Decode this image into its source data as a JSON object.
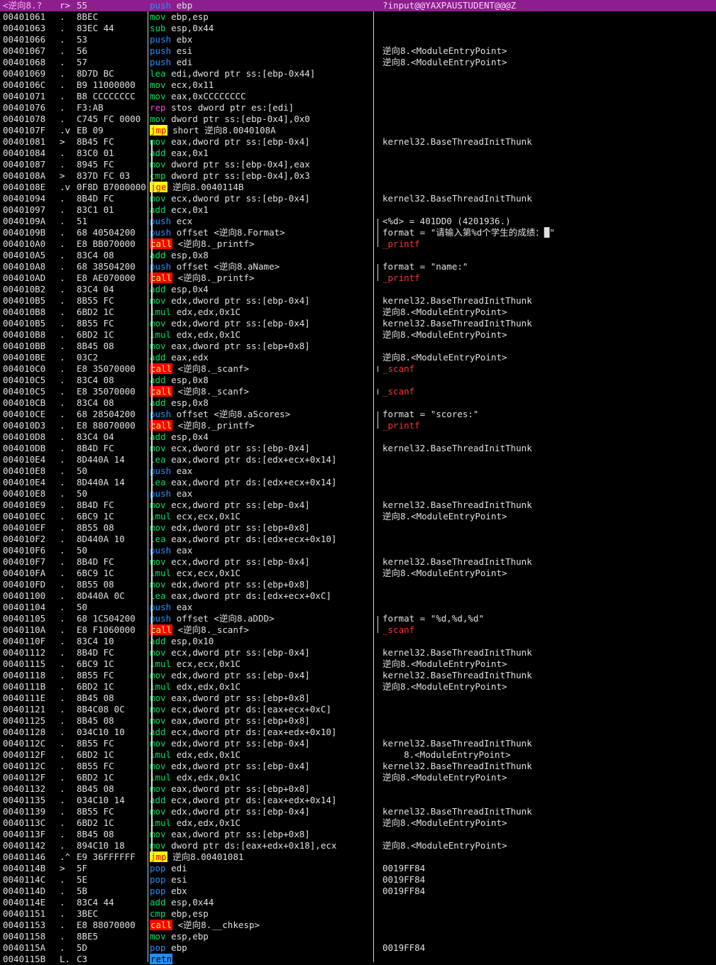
{
  "view": "disassembly",
  "selected_row_index": 0,
  "colors": {
    "background": "#000000",
    "selection": "#8e1e8e",
    "push_pop": "#1e90ff",
    "mov_add": "#00e060",
    "rep": "#ff3fd0",
    "call_bg": "#ff0000",
    "jump_bg": "#ffff00",
    "retn_bg": "#1e90ff",
    "func_comment": "#ff3030"
  },
  "rows": [
    {
      "addr": "<逆向8.?",
      "flow": "r>",
      "hex": "55",
      "mn": "push",
      "ops": "ebp",
      "cmt": "?input@@YAXPAUSTUDENT@@@Z"
    },
    {
      "addr": "00401061",
      "flow": ".",
      "hex": "8BEC",
      "mn": "mov",
      "ops": "ebp,esp",
      "cmt": ""
    },
    {
      "addr": "00401063",
      "flow": ".",
      "hex": "83EC 44",
      "mn": "sub",
      "ops": "esp,0x44",
      "cmt": ""
    },
    {
      "addr": "00401066",
      "flow": ".",
      "hex": "53",
      "mn": "push",
      "ops": "ebx",
      "cmt": ""
    },
    {
      "addr": "00401067",
      "flow": ".",
      "hex": "56",
      "mn": "push",
      "ops": "esi",
      "cmt": "逆向8.<ModuleEntryPoint>"
    },
    {
      "addr": "00401068",
      "flow": ".",
      "hex": "57",
      "mn": "push",
      "ops": "edi",
      "cmt": "逆向8.<ModuleEntryPoint>"
    },
    {
      "addr": "00401069",
      "flow": ".",
      "hex": "8D7D BC",
      "mn": "lea",
      "ops": "edi,dword ptr ss:[ebp-0x44]",
      "cmt": ""
    },
    {
      "addr": "0040106C",
      "flow": ".",
      "hex": "B9 11000000",
      "mn": "mov",
      "ops": "ecx,0x11",
      "cmt": ""
    },
    {
      "addr": "00401071",
      "flow": ".",
      "hex": "B8 CCCCCCCC",
      "mn": "mov",
      "ops": "eax,0xCCCCCCCC",
      "cmt": ""
    },
    {
      "addr": "00401076",
      "flow": ".",
      "hex": "F3:AB",
      "mn": "rep",
      "ops": "stos dword ptr es:[edi]",
      "cmt": ""
    },
    {
      "addr": "00401078",
      "flow": ".",
      "hex": "C745 FC 0000",
      "mn": "mov",
      "ops": "dword ptr ss:[ebp-0x4],0x0",
      "cmt": ""
    },
    {
      "addr": "0040107F",
      "flow": ".v",
      "hex": "EB 09",
      "mn": "jmp",
      "ops": "short 逆向8.0040108A",
      "cmt": ""
    },
    {
      "addr": "00401081",
      "flow": ">",
      "hex": "8B45 FC",
      "mn": "mov",
      "ops": "eax,dword ptr ss:[ebp-0x4]",
      "cmt": "kernel32.BaseThreadInitThunk"
    },
    {
      "addr": "00401084",
      "flow": ".",
      "hex": "83C0 01",
      "mn": "add",
      "ops": "eax,0x1",
      "cmt": ""
    },
    {
      "addr": "00401087",
      "flow": ".",
      "hex": "8945 FC",
      "mn": "mov",
      "ops": "dword ptr ss:[ebp-0x4],eax",
      "cmt": ""
    },
    {
      "addr": "0040108A",
      "flow": ">",
      "hex": "837D FC 03",
      "mn": "cmp",
      "ops": "dword ptr ss:[ebp-0x4],0x3",
      "cmt": ""
    },
    {
      "addr": "0040108E",
      "flow": ".v",
      "hex": "0F8D B7000000",
      "mn": "jge",
      "ops": "逆向8.0040114B",
      "cmt": ""
    },
    {
      "addr": "00401094",
      "flow": ".",
      "hex": "8B4D FC",
      "mn": "mov",
      "ops": "ecx,dword ptr ss:[ebp-0x4]",
      "cmt": "kernel32.BaseThreadInitThunk"
    },
    {
      "addr": "00401097",
      "flow": ".",
      "hex": "83C1 01",
      "mn": "add",
      "ops": "ecx,0x1",
      "cmt": ""
    },
    {
      "addr": "0040109A",
      "flow": ".",
      "hex": "51",
      "mn": "push",
      "ops": "ecx",
      "cmt": "<%d> = 401DD0 (4201936.)"
    },
    {
      "addr": "0040109B",
      "flow": ".",
      "hex": "68 40504200",
      "mn": "push",
      "ops": "offset <逆向8.Format>",
      "cmt": "format = \"请输入第%d个学生的成绩：█\""
    },
    {
      "addr": "004010A0",
      "flow": ".",
      "hex": "E8 BB070000",
      "mn": "call",
      "ops": "<逆向8._printf>",
      "cmt": "_printf"
    },
    {
      "addr": "004010A5",
      "flow": ".",
      "hex": "83C4 08",
      "mn": "add",
      "ops": "esp,0x8",
      "cmt": ""
    },
    {
      "addr": "004010A8",
      "flow": ".",
      "hex": "68 38504200",
      "mn": "push",
      "ops": "offset <逆向8.aName>",
      "cmt": "format = \"name:\""
    },
    {
      "addr": "004010AD",
      "flow": ".",
      "hex": "E8 AE070000",
      "mn": "call",
      "ops": "<逆向8._printf>",
      "cmt": "_printf"
    },
    {
      "addr": "004010B2",
      "flow": ".",
      "hex": "83C4 04",
      "mn": "add",
      "ops": "esp,0x4",
      "cmt": ""
    },
    {
      "addr": "004010B5",
      "flow": ".",
      "hex": "8B55 FC",
      "mn": "mov",
      "ops": "edx,dword ptr ss:[ebp-0x4]",
      "cmt": "kernel32.BaseThreadInitThunk"
    },
    {
      "addr": "004010B8",
      "flow": ".",
      "hex": "6BD2 1C",
      "mn": "imul",
      "ops": "edx,edx,0x1C",
      "cmt": "逆向8.<ModuleEntryPoint>"
    },
    {
      "addr": "004010B5",
      "flow": ".",
      "hex": "8B55 FC",
      "mn": "mov",
      "ops": "edx,dword ptr ss:[ebp-0x4]",
      "cmt": "kernel32.BaseThreadInitThunk"
    },
    {
      "addr": "004010B8",
      "flow": ".",
      "hex": "6BD2 1C",
      "mn": "imul",
      "ops": "edx,edx,0x1C",
      "cmt": "逆向8.<ModuleEntryPoint>"
    },
    {
      "addr": "004010BB",
      "flow": ".",
      "hex": "8B45 08",
      "mn": "mov",
      "ops": "eax,dword ptr ss:[ebp+0x8]",
      "cmt": ""
    },
    {
      "addr": "004010BE",
      "flow": ".",
      "hex": "03C2",
      "mn": "add",
      "ops": "eax,edx",
      "cmt": "逆向8.<ModuleEntryPoint>"
    },
    {
      "addr": "004010C0",
      "flow": ".",
      "hex": "E8 35070000",
      "mn": "call",
      "ops": "<逆向8._scanf>",
      "cmt": "_scanf"
    },
    {
      "addr": "004010C5",
      "flow": ".",
      "hex": "83C4 08",
      "mn": "add",
      "ops": "esp,0x8",
      "cmt": ""
    },
    {
      "addr": "004010C5",
      "flow": ".",
      "hex": "E8 35070000",
      "mn": "call",
      "ops": "<逆向8._scanf>",
      "cmt": "_scanf"
    },
    {
      "addr": "004010CB",
      "flow": ".",
      "hex": "83C4 08",
      "mn": "add",
      "ops": "esp,0x8",
      "cmt": ""
    },
    {
      "addr": "004010CE",
      "flow": ".",
      "hex": "68 28504200",
      "mn": "push",
      "ops": "offset <逆向8.aScores>",
      "cmt": "format = \"scores:\""
    },
    {
      "addr": "004010D3",
      "flow": ".",
      "hex": "E8 88070000",
      "mn": "call",
      "ops": "<逆向8._printf>",
      "cmt": "_printf"
    },
    {
      "addr": "004010D8",
      "flow": ".",
      "hex": "83C4 04",
      "mn": "add",
      "ops": "esp,0x4",
      "cmt": ""
    },
    {
      "addr": "004010DB",
      "flow": ".",
      "hex": "8B4D FC",
      "mn": "mov",
      "ops": "ecx,dword ptr ss:[ebp-0x4]",
      "cmt": "kernel32.BaseThreadInitThunk"
    },
    {
      "addr": "004010E4",
      "flow": ".",
      "hex": "8D440A 14",
      "mn": "lea",
      "ops": "eax,dword ptr ds:[edx+ecx+0x14]",
      "cmt": ""
    },
    {
      "addr": "004010E8",
      "flow": ".",
      "hex": "50",
      "mn": "push",
      "ops": "eax",
      "cmt": ""
    },
    {
      "addr": "004010E4",
      "flow": ".",
      "hex": "8D440A 14",
      "mn": "lea",
      "ops": "eax,dword ptr ds:[edx+ecx+0x14]",
      "cmt": ""
    },
    {
      "addr": "004010E8",
      "flow": ".",
      "hex": "50",
      "mn": "push",
      "ops": "eax",
      "cmt": ""
    },
    {
      "addr": "004010E9",
      "flow": ".",
      "hex": "8B4D FC",
      "mn": "mov",
      "ops": "ecx,dword ptr ss:[ebp-0x4]",
      "cmt": "kernel32.BaseThreadInitThunk"
    },
    {
      "addr": "004010EC",
      "flow": ".",
      "hex": "6BC9 1C",
      "mn": "imul",
      "ops": "ecx,ecx,0x1C",
      "cmt": "逆向8.<ModuleEntryPoint>"
    },
    {
      "addr": "004010EF",
      "flow": ".",
      "hex": "8B55 08",
      "mn": "mov",
      "ops": "edx,dword ptr ss:[ebp+0x8]",
      "cmt": ""
    },
    {
      "addr": "004010F2",
      "flow": ".",
      "hex": "8D440A 10",
      "mn": "lea",
      "ops": "eax,dword ptr ds:[edx+ecx+0x10]",
      "cmt": ""
    },
    {
      "addr": "004010F6",
      "flow": ".",
      "hex": "50",
      "mn": "push",
      "ops": "eax",
      "cmt": ""
    },
    {
      "addr": "004010F7",
      "flow": ".",
      "hex": "8B4D FC",
      "mn": "mov",
      "ops": "ecx,dword ptr ss:[ebp-0x4]",
      "cmt": "kernel32.BaseThreadInitThunk"
    },
    {
      "addr": "004010FA",
      "flow": ".",
      "hex": "6BC9 1C",
      "mn": "imul",
      "ops": "ecx,ecx,0x1C",
      "cmt": "逆向8.<ModuleEntryPoint>"
    },
    {
      "addr": "004010FD",
      "flow": ".",
      "hex": "8B55 08",
      "mn": "mov",
      "ops": "edx,dword ptr ss:[ebp+0x8]",
      "cmt": ""
    },
    {
      "addr": "00401100",
      "flow": ".",
      "hex": "8D440A 0C",
      "mn": "lea",
      "ops": "eax,dword ptr ds:[edx+ecx+0xC]",
      "cmt": ""
    },
    {
      "addr": "00401104",
      "flow": ".",
      "hex": "50",
      "mn": "push",
      "ops": "eax",
      "cmt": ""
    },
    {
      "addr": "00401105",
      "flow": ".",
      "hex": "68 1C504200",
      "mn": "push",
      "ops": "offset <逆向8.aDDD>",
      "cmt": "format = \"%d,%d,%d\""
    },
    {
      "addr": "0040110A",
      "flow": ".",
      "hex": "E8 F1060000",
      "mn": "call",
      "ops": "<逆向8._scanf>",
      "cmt": "_scanf"
    },
    {
      "addr": "0040110F",
      "flow": ".",
      "hex": "83C4 10",
      "mn": "add",
      "ops": "esp,0x10",
      "cmt": ""
    },
    {
      "addr": "00401112",
      "flow": ".",
      "hex": "8B4D FC",
      "mn": "mov",
      "ops": "ecx,dword ptr ss:[ebp-0x4]",
      "cmt": "kernel32.BaseThreadInitThunk"
    },
    {
      "addr": "00401115",
      "flow": ".",
      "hex": "6BC9 1C",
      "mn": "imul",
      "ops": "ecx,ecx,0x1C",
      "cmt": "逆向8.<ModuleEntryPoint>"
    },
    {
      "addr": "00401118",
      "flow": ".",
      "hex": "8B55 FC",
      "mn": "mov",
      "ops": "edx,dword ptr ss:[ebp-0x4]",
      "cmt": "kernel32.BaseThreadInitThunk"
    },
    {
      "addr": "0040111B",
      "flow": ".",
      "hex": "6BD2 1C",
      "mn": "imul",
      "ops": "edx,edx,0x1C",
      "cmt": "逆向8.<ModuleEntryPoint>"
    },
    {
      "addr": "0040111E",
      "flow": ".",
      "hex": "8B45 08",
      "mn": "mov",
      "ops": "eax,dword ptr ss:[ebp+0x8]",
      "cmt": ""
    },
    {
      "addr": "00401121",
      "flow": ".",
      "hex": "8B4C08 0C",
      "mn": "mov",
      "ops": "ecx,dword ptr ds:[eax+ecx+0xC]",
      "cmt": ""
    },
    {
      "addr": "00401125",
      "flow": ".",
      "hex": "8B45 08",
      "mn": "mov",
      "ops": "eax,dword ptr ss:[ebp+0x8]",
      "cmt": ""
    },
    {
      "addr": "00401128",
      "flow": ".",
      "hex": "034C10 10",
      "mn": "add",
      "ops": "ecx,dword ptr ds:[eax+edx+0x10]",
      "cmt": ""
    },
    {
      "addr": "0040112C",
      "flow": ".",
      "hex": "8B55 FC",
      "mn": "mov",
      "ops": "edx,dword ptr ss:[ebp-0x4]",
      "cmt": "kernel32.BaseThreadInitThunk"
    },
    {
      "addr": "0040112F",
      "flow": ".",
      "hex": "6BD2 1C",
      "mn": "imul",
      "ops": "edx,edx,0x1C",
      "cmt": "    8.<ModuleEntryPoint>"
    },
    {
      "addr": "0040112C",
      "flow": ".",
      "hex": "8B55 FC",
      "mn": "mov",
      "ops": "edx,dword ptr ss:[ebp-0x4]",
      "cmt": "kernel32.BaseThreadInitThunk"
    },
    {
      "addr": "0040112F",
      "flow": ".",
      "hex": "6BD2 1C",
      "mn": "imul",
      "ops": "edx,edx,0x1C",
      "cmt": "逆向8.<ModuleEntryPoint>"
    },
    {
      "addr": "00401132",
      "flow": ".",
      "hex": "8B45 08",
      "mn": "mov",
      "ops": "eax,dword ptr ss:[ebp+0x8]",
      "cmt": ""
    },
    {
      "addr": "00401135",
      "flow": ".",
      "hex": "034C10 14",
      "mn": "add",
      "ops": "ecx,dword ptr ds:[eax+edx+0x14]",
      "cmt": ""
    },
    {
      "addr": "00401139",
      "flow": ".",
      "hex": "8B55 FC",
      "mn": "mov",
      "ops": "edx,dword ptr ss:[ebp-0x4]",
      "cmt": "kernel32.BaseThreadInitThunk"
    },
    {
      "addr": "0040113C",
      "flow": ".",
      "hex": "6BD2 1C",
      "mn": "imul",
      "ops": "edx,edx,0x1C",
      "cmt": "逆向8.<ModuleEntryPoint>"
    },
    {
      "addr": "0040113F",
      "flow": ".",
      "hex": "8B45 08",
      "mn": "mov",
      "ops": "eax,dword ptr ss:[ebp+0x8]",
      "cmt": ""
    },
    {
      "addr": "00401142",
      "flow": ".",
      "hex": "894C10 18",
      "mn": "mov",
      "ops": "dword ptr ds:[eax+edx+0x18],ecx",
      "cmt": "逆向8.<ModuleEntryPoint>"
    },
    {
      "addr": "00401146",
      "flow": ".^",
      "hex": "E9 36FFFFFF",
      "mn": "jmp",
      "ops": "逆向8.00401081",
      "cmt": ""
    },
    {
      "addr": "0040114B",
      "flow": ">",
      "hex": "5F",
      "mn": "pop",
      "ops": "edi",
      "cmt": "0019FF84"
    },
    {
      "addr": "0040114C",
      "flow": ".",
      "hex": "5E",
      "mn": "pop",
      "ops": "esi",
      "cmt": "0019FF84"
    },
    {
      "addr": "0040114D",
      "flow": ".",
      "hex": "5B",
      "mn": "pop",
      "ops": "ebx",
      "cmt": "0019FF84"
    },
    {
      "addr": "0040114E",
      "flow": ".",
      "hex": "83C4 44",
      "mn": "add",
      "ops": "esp,0x44",
      "cmt": ""
    },
    {
      "addr": "00401151",
      "flow": ".",
      "hex": "3BEC",
      "mn": "cmp",
      "ops": "ebp,esp",
      "cmt": ""
    },
    {
      "addr": "00401153",
      "flow": ".",
      "hex": "E8 88070000",
      "mn": "call",
      "ops": "<逆向8.__chkesp>",
      "cmt": ""
    },
    {
      "addr": "00401158",
      "flow": ".",
      "hex": "8BE5",
      "mn": "mov",
      "ops": "esp,ebp",
      "cmt": ""
    },
    {
      "addr": "0040115A",
      "flow": ".",
      "hex": "5D",
      "mn": "pop",
      "ops": "ebp",
      "cmt": "0019FF84"
    },
    {
      "addr": "0040115B",
      "flow": "L.",
      "hex": "C3",
      "mn": "retn",
      "ops": "",
      "cmt": ""
    }
  ]
}
